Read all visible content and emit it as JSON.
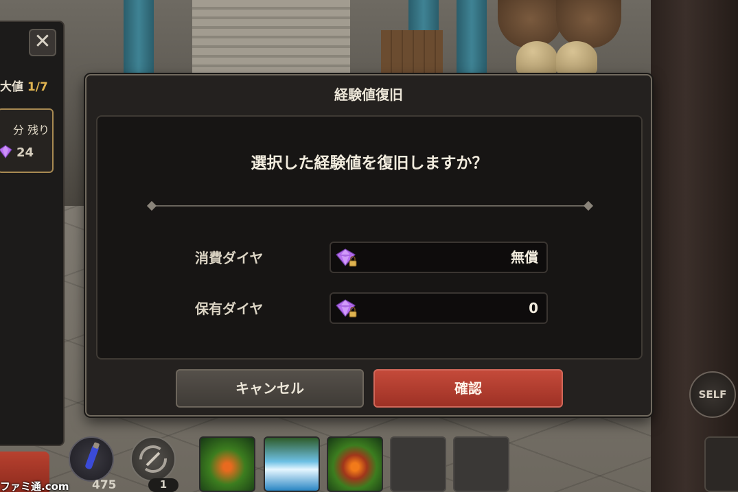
{
  "side_panel": {
    "close_glyph": "✕",
    "max_label": "大値",
    "max_fraction": "1/7",
    "remain_label": "分 残り",
    "gem_count": "24"
  },
  "dialog": {
    "title": "経験値復旧",
    "question": "選択した経験値を復旧しますか？",
    "cost_label": "消費ダイヤ",
    "cost_value": "無償",
    "owned_label": "保有ダイヤ",
    "owned_value": "0",
    "cancel_label": "キャンセル",
    "confirm_label": "確認"
  },
  "hud": {
    "potion_count": "475",
    "swap_count": "1",
    "self_label": "SELF"
  },
  "watermark": "ファミ通.com",
  "colors": {
    "accent_gold": "#e0b450",
    "confirm_red": "#b53f30",
    "gem_purple": "#b86ff0"
  },
  "icons": {
    "gem": "locked-diamond-icon",
    "close": "close-icon"
  }
}
